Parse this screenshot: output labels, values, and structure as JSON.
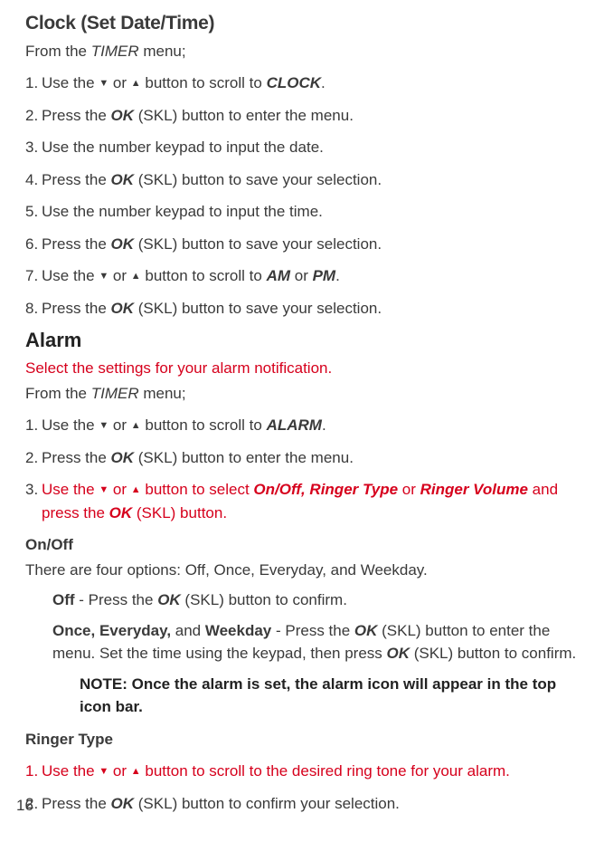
{
  "section1": {
    "heading": "Clock (Set Date/Time)",
    "from_menu_pre": "From the ",
    "from_menu_em": "TIMER",
    "from_menu_post": " menu;",
    "steps": [
      {
        "num": "1.",
        "pre": "Use the ",
        "mid": " or ",
        "post": "  button to scroll to ",
        "target": "CLOCK",
        "end": "."
      },
      {
        "num": "2.",
        "pre": "Press the ",
        "ok": "OK",
        "post": " (SKL) button to enter the menu."
      },
      {
        "num": "3.",
        "text": "Use the number keypad to input the date."
      },
      {
        "num": "4.",
        "pre": "Press the ",
        "ok": "OK",
        "post": " (SKL) button to save your selection."
      },
      {
        "num": "5.",
        "text": "Use the number keypad to input the time."
      },
      {
        "num": "6.",
        "pre": "Press the ",
        "ok": "OK",
        "post": " (SKL) button to save your selection."
      },
      {
        "num": "7.",
        "pre": "Use the ",
        "mid": " or ",
        "post": "  button to scroll to ",
        "t1": "AM",
        "tor": " or ",
        "t2": "PM",
        "end": "."
      },
      {
        "num": "8.",
        "pre": "Press the ",
        "ok": "OK",
        "post": " (SKL) button to save your selection."
      }
    ]
  },
  "section2": {
    "heading": "Alarm",
    "redline": "Select the settings for your alarm notification.",
    "from_menu_pre": "From the ",
    "from_menu_em": "TIMER",
    "from_menu_post": " menu;",
    "step1": {
      "num": "1.",
      "pre": "Use the ",
      "mid": " or ",
      "post": "  button to scroll to ",
      "target": "ALARM",
      "end": "."
    },
    "step2": {
      "num": "2.",
      "pre": "Press the ",
      "ok": "OK",
      "post": " (SKL) button to enter the menu."
    },
    "step3": {
      "num": "3.",
      "pre": "Use the ",
      "mid": " or ",
      "post": "  button to select ",
      "opt1": "On/Off, Ringer Type",
      "or": " or ",
      "opt2": "Ringer Volume",
      "tail1": " and press the ",
      "ok": "OK",
      "tail2": " (SKL) button."
    }
  },
  "onoff": {
    "heading": "On/Off",
    "desc": "There are four options: Off, Once, Everyday, and Weekday.",
    "off_label": "Off",
    "off_pre": " - Press the ",
    "off_ok": "OK",
    "off_post": " (SKL) button to confirm.",
    "rest_label": "Once, Everyday,",
    "rest_and": " and ",
    "rest_wk": "Weekday",
    "rest_pre": " -  Press the ",
    "rest_ok": "OK",
    "rest_post1": " (SKL) button to enter the menu. Set the time using the keypad, then press ",
    "rest_ok2": "OK",
    "rest_post2": " (SKL) button to confirm.",
    "note": "NOTE: Once the alarm is set, the alarm icon will appear in the top icon bar."
  },
  "ringer": {
    "heading": "Ringer Type",
    "step1": {
      "num": "1.",
      "pre": "Use the ",
      "mid": " or ",
      "post": "  button to scroll to the desired ring tone for your alarm."
    },
    "step2": {
      "num": "2.",
      "pre": "Press the ",
      "ok": "OK",
      "post": " (SKL) button to confirm your selection."
    }
  },
  "arrows": {
    "down": "▼",
    "up": "▲"
  },
  "pagenum": "16"
}
